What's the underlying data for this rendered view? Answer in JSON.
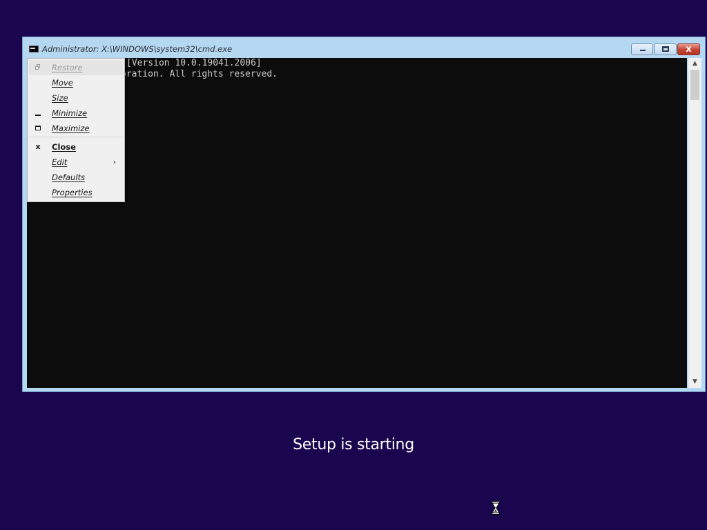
{
  "window": {
    "title": "Administrator: X:\\WINDOWS\\system32\\cmd.exe",
    "icon": "cmd-icon",
    "controls": {
      "minimize": "minimize-icon",
      "maximize": "maximize-icon",
      "close": "close-icon",
      "close_glyph": "x"
    }
  },
  "console": {
    "lines": [
      "[Version 10.0.19041.2006]",
      "oration. All rights reserved."
    ]
  },
  "scrollbar": {
    "up_glyph": "▲",
    "down_glyph": "▼"
  },
  "system_menu": {
    "items": [
      {
        "label": "Restore",
        "icon": "restore-icon",
        "enabled": false
      },
      {
        "label": "Move",
        "icon": "",
        "enabled": true
      },
      {
        "label": "Size",
        "icon": "",
        "enabled": true
      },
      {
        "label": "Minimize",
        "icon": "minimize-icon",
        "enabled": true
      },
      {
        "label": "Maximize",
        "icon": "maximize-icon",
        "enabled": true
      },
      {
        "label": "Close",
        "icon": "close-icon",
        "glyph": "x",
        "enabled": true,
        "bold": true
      },
      {
        "label": "Edit",
        "icon": "",
        "enabled": true,
        "submenu": "›"
      },
      {
        "label": "Defaults",
        "icon": "",
        "enabled": true
      },
      {
        "label": "Properties",
        "icon": "",
        "enabled": true
      }
    ]
  },
  "setup": {
    "status": "Setup is starting",
    "cursor": "hourglass-icon"
  },
  "colors": {
    "desktop_background": "#1a064e",
    "console_background": "#0c0c0c",
    "console_text": "#cccccc",
    "window_frame": "#b4d7f2",
    "close_button": "#c44433"
  }
}
